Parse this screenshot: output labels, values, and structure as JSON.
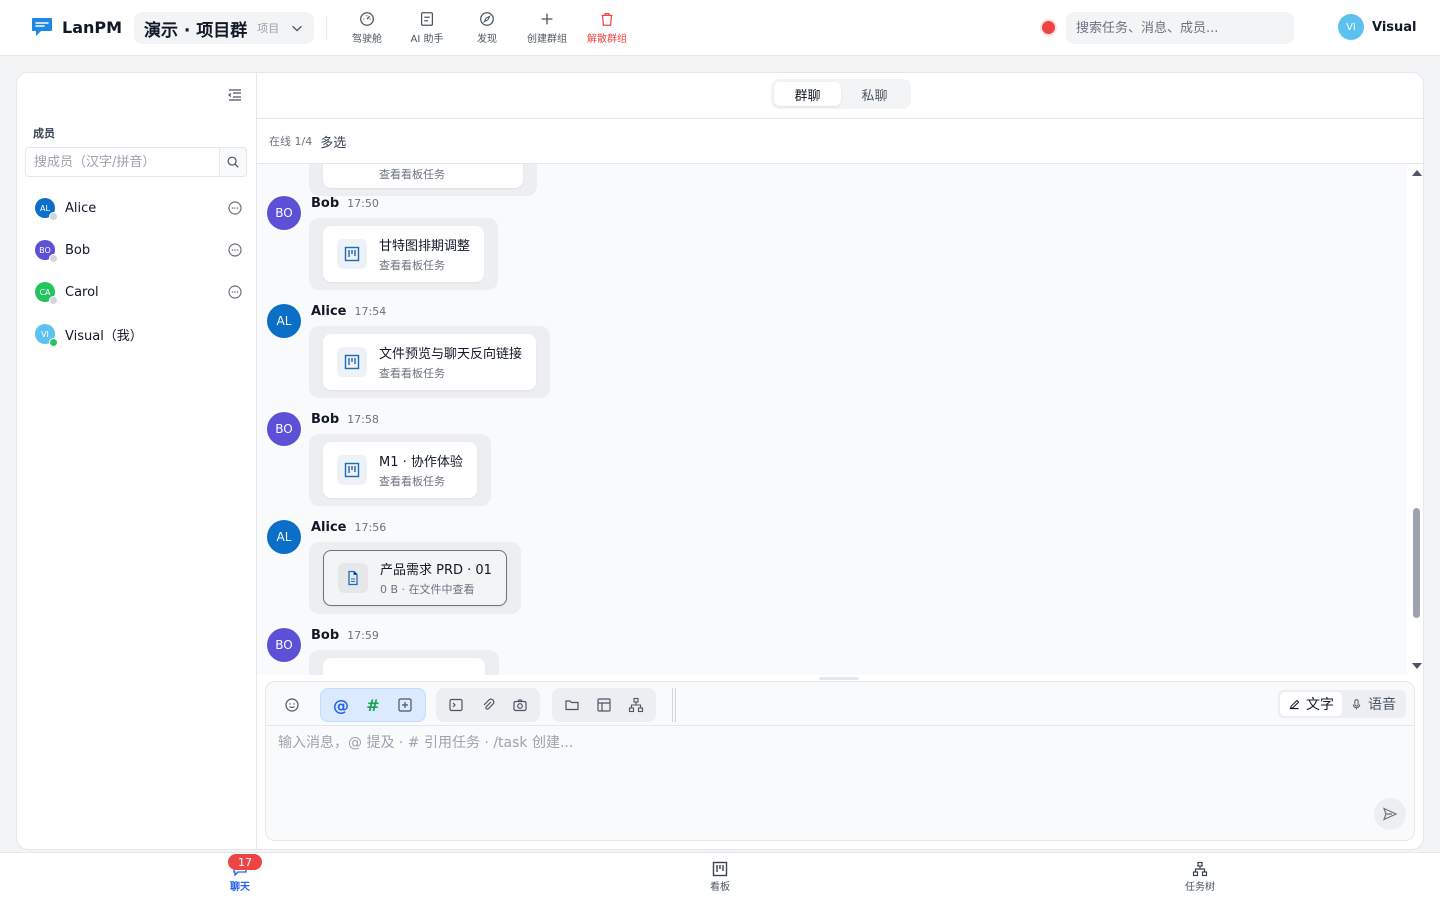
{
  "app": {
    "name": "LanPM"
  },
  "project": {
    "name": "演示 · 项目群",
    "tag": "项目"
  },
  "toolbar": {
    "items": [
      {
        "label": "驾驶舱",
        "icon": "dashboard-icon"
      },
      {
        "label": "AI 助手",
        "icon": "ai-assistant-icon"
      },
      {
        "label": "发现",
        "icon": "compass-icon"
      },
      {
        "label": "创建群组",
        "icon": "plus-icon"
      },
      {
        "label": "解散群组",
        "icon": "trash-icon",
        "color": "#ef4444"
      }
    ]
  },
  "search": {
    "placeholder": "搜索任务、消息、成员..."
  },
  "user": {
    "initials": "VI",
    "name": "Visual",
    "avatar_color": "#5bc2f0"
  },
  "sidebar": {
    "title": "成员",
    "search_placeholder": "搜成员（汉字/拼音）",
    "members": [
      {
        "initials": "AL",
        "name": "Alice",
        "color": "#0b6ec7",
        "online": false,
        "dm": true
      },
      {
        "initials": "BO",
        "name": "Bob",
        "color": "#5b50d6",
        "online": false,
        "dm": true
      },
      {
        "initials": "CA",
        "name": "Carol",
        "color": "#22c55e",
        "online": false,
        "dm": true
      },
      {
        "initials": "VI",
        "name": "Visual（我）",
        "color": "#5bc2f0",
        "online": true,
        "dm": false
      }
    ]
  },
  "chat": {
    "tabs": [
      {
        "label": "群聊",
        "active": true
      },
      {
        "label": "私聊",
        "active": false
      }
    ],
    "online_count": "在线 1/4",
    "multi_select": "多选",
    "top_partial_card_sub": "查看看板任务",
    "messages": [
      {
        "initials": "BO",
        "author": "Bob",
        "time": "17:50",
        "color": "#5b50d6",
        "kind": "task",
        "title": "甘特图排期调整",
        "sub": "查看看板任务"
      },
      {
        "initials": "AL",
        "author": "Alice",
        "time": "17:54",
        "color": "#0b6ec7",
        "kind": "task",
        "title": "文件预览与聊天反向链接",
        "sub": "查看看板任务"
      },
      {
        "initials": "BO",
        "author": "Bob",
        "time": "17:58",
        "color": "#5b50d6",
        "kind": "task",
        "title": "M1 · 协作体验",
        "sub": "查看看板任务"
      },
      {
        "initials": "AL",
        "author": "Alice",
        "time": "17:56",
        "color": "#0b6ec7",
        "kind": "file",
        "title": "产品需求 PRD · 01",
        "sub": "0 B · 在文件中查看"
      },
      {
        "initials": "BO",
        "author": "Bob",
        "time": "17:59",
        "color": "#5b50d6",
        "kind": "partial"
      }
    ]
  },
  "composer": {
    "placeholder": "输入消息，@ 提及 · # 引用任务 · /task 创建...",
    "mention": "@",
    "hash": "#",
    "modes": [
      {
        "label": "文字",
        "active": true
      },
      {
        "label": "语音",
        "active": false
      }
    ]
  },
  "bottomnav": {
    "badge": "17",
    "items": [
      {
        "label": "聊天",
        "active": true
      },
      {
        "label": "看板",
        "active": false
      },
      {
        "label": "任务树",
        "active": false
      }
    ]
  },
  "colors": {
    "accent": "#2563eb",
    "danger": "#ef4444",
    "online": "#22c55e"
  }
}
